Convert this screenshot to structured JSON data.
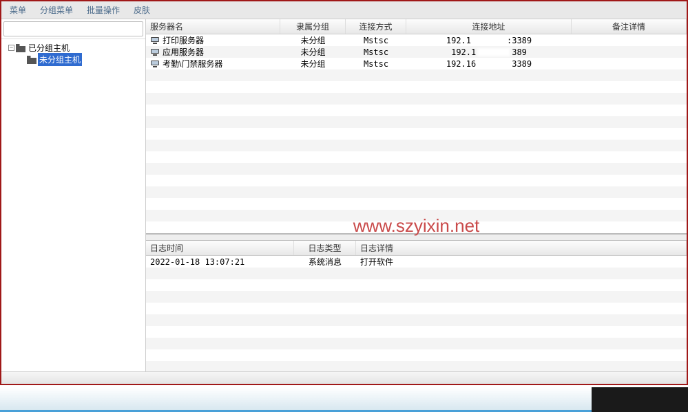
{
  "menu": {
    "items": [
      "菜单",
      "分组菜单",
      "批量操作",
      "皮肤"
    ]
  },
  "search": {
    "placeholder": ""
  },
  "tree": {
    "root": {
      "label": "已分组主机",
      "expanded": true
    },
    "children": [
      {
        "label": "未分组主机",
        "selected": true
      }
    ]
  },
  "servers": {
    "columns": {
      "name": "服务器名",
      "group": "隶属分组",
      "conn": "连接方式",
      "addr": "连接地址",
      "remark": "备注详情"
    },
    "rows": [
      {
        "name": "打印服务器",
        "group": "未分组",
        "conn": "Mstsc",
        "addr_a": "192.1",
        "addr_b": ":3389"
      },
      {
        "name": "应用服务器",
        "group": "未分组",
        "conn": "Mstsc",
        "addr_a": "192.1",
        "addr_b": "389"
      },
      {
        "name": "考勤\\门禁服务器",
        "group": "未分组",
        "conn": "Mstsc",
        "addr_a": "192.16",
        "addr_b": "3389"
      }
    ]
  },
  "logs": {
    "columns": {
      "time": "日志时间",
      "type": "日志类型",
      "detail": "日志详情"
    },
    "rows": [
      {
        "time": "2022-01-18 13:07:21",
        "type": "系统消息",
        "detail": "打开软件"
      }
    ]
  },
  "watermark": "www.szyixin.net",
  "taskbar": {
    "dark_text": ""
  }
}
